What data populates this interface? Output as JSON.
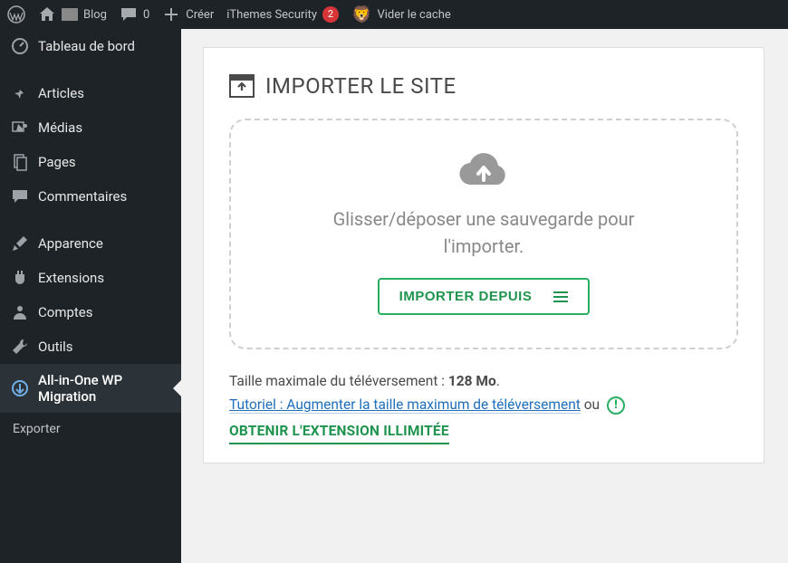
{
  "adminbar": {
    "site_name": "Blog",
    "comments_count": "0",
    "new_label": "Créer",
    "security_label": "iThemes Security",
    "security_count": "2",
    "cache_label": "Vider le cache"
  },
  "sidebar": {
    "items": [
      {
        "label": "Tableau de bord",
        "icon": "dashboard"
      },
      {
        "label": "Articles",
        "icon": "pin"
      },
      {
        "label": "Médias",
        "icon": "media"
      },
      {
        "label": "Pages",
        "icon": "pages"
      },
      {
        "label": "Commentaires",
        "icon": "comments"
      },
      {
        "label": "Apparence",
        "icon": "appearance"
      },
      {
        "label": "Extensions",
        "icon": "plugins"
      },
      {
        "label": "Comptes",
        "icon": "users"
      },
      {
        "label": "Outils",
        "icon": "tools"
      },
      {
        "label": "All-in-One WP Migration",
        "icon": "migration",
        "active": true
      }
    ],
    "submenu_label": "Exporter"
  },
  "main": {
    "page_title": "IMPORTER LE SITE",
    "dropzone_text": "Glisser/déposer une sauvegarde pour l'importer.",
    "import_button": "IMPORTER DEPUIS",
    "max_upload_label": "Taille maximale du téléversement :",
    "max_upload_value": "128 Mo",
    "max_upload_suffix": ".",
    "tutorial_link": "Tutoriel : Augmenter la taille maximum de téléversement",
    "or_text": "ou",
    "unlimited_link": "OBTENIR L'EXTENSION ILLIMITÉE"
  }
}
